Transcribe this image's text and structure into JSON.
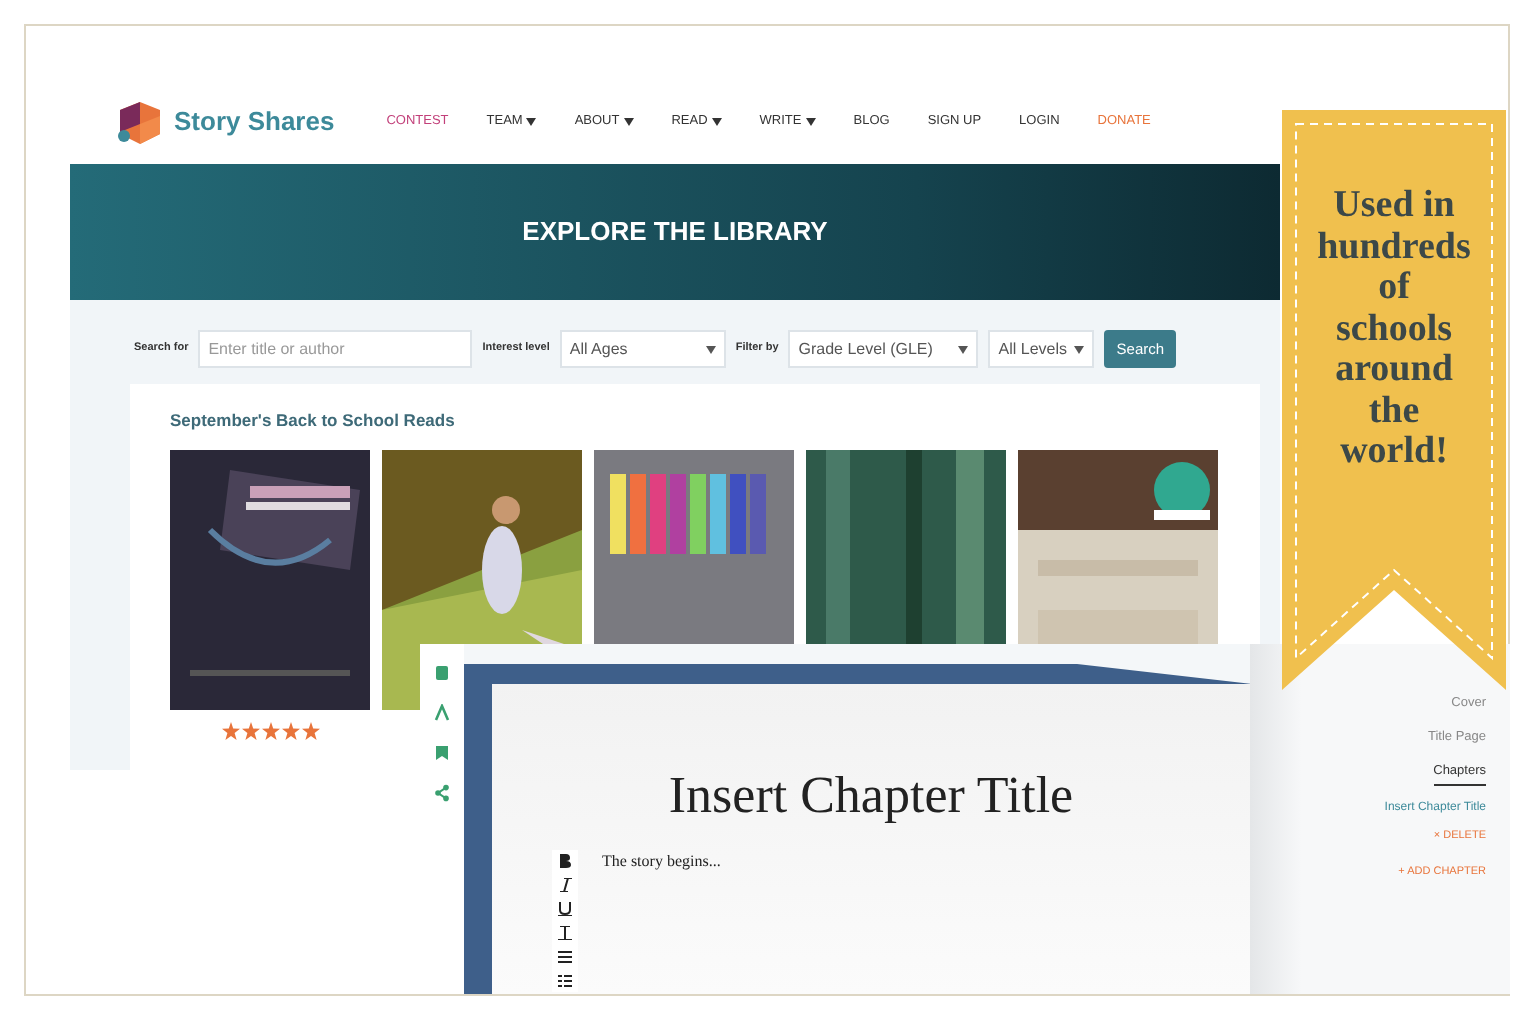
{
  "logo": {
    "text": "Story Shares"
  },
  "nav": [
    {
      "label": "CONTEST",
      "dropdown": false,
      "color": "#c2407a"
    },
    {
      "label": "TEAM",
      "dropdown": true,
      "color": "#333333"
    },
    {
      "label": "ABOUT",
      "dropdown": true,
      "color": "#333333"
    },
    {
      "label": "READ",
      "dropdown": true,
      "color": "#333333"
    },
    {
      "label": "WRITE",
      "dropdown": true,
      "color": "#333333"
    },
    {
      "label": "BLOG",
      "dropdown": false,
      "color": "#333333"
    },
    {
      "label": "SIGN UP",
      "dropdown": false,
      "color": "#333333"
    },
    {
      "label": "LOGIN",
      "dropdown": false,
      "color": "#333333"
    },
    {
      "label": "DONATE",
      "dropdown": false,
      "color": "#e8743b"
    }
  ],
  "hero": {
    "title": "EXPLORE THE LIBRARY"
  },
  "search": {
    "label": "Search for",
    "placeholder": "Enter title or author",
    "interest_label": "Interest level",
    "interest_value": "All Ages",
    "filter_label": "Filter by",
    "filter_value": "Grade Level (GLE)",
    "levels_value": "All Levels",
    "button": "Search"
  },
  "shelf": {
    "title": "September's Back to School Reads",
    "books": [
      {
        "kind": "picture",
        "stars": 5
      },
      {
        "kind": "picture"
      },
      {
        "kind": "picture"
      },
      {
        "kind": "picture"
      },
      {
        "kind": "picture"
      }
    ]
  },
  "editor": {
    "chapter_title": "Insert Chapter Title",
    "body": "The story begins...",
    "nav": [
      {
        "label": "Cover",
        "selected": false
      },
      {
        "label": "Title Page",
        "selected": false
      },
      {
        "label": "Chapters",
        "selected": true
      }
    ],
    "chapter": "Insert Chapter Title",
    "delete": "× DELETE",
    "add": "+ ADD CHAPTER"
  },
  "ribbon": {
    "lines": [
      "Used in",
      "hundreds",
      "of",
      "schools",
      "around",
      "the",
      "world!"
    ]
  }
}
